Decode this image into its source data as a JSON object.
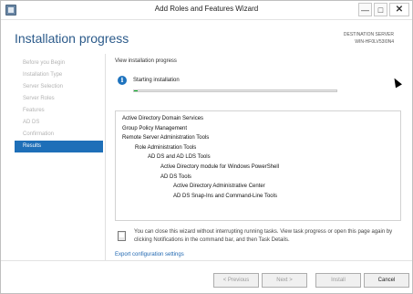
{
  "window": {
    "title": "Add Roles and Features Wizard",
    "minimize_glyph": "—",
    "maximize_glyph": "□",
    "close_glyph": "✕"
  },
  "header": {
    "title": "Installation progress",
    "destination_label": "DESTINATION SERVER",
    "destination_server": "WIN-HF0LV53I0N4"
  },
  "nav": {
    "items": [
      {
        "label": "Before you Begin",
        "active": false
      },
      {
        "label": "Installation Type",
        "active": false
      },
      {
        "label": "Server Selection",
        "active": false
      },
      {
        "label": "Server Roles",
        "active": false
      },
      {
        "label": "Features",
        "active": false
      },
      {
        "label": "AD DS",
        "active": false
      },
      {
        "label": "Confirmation",
        "active": false
      },
      {
        "label": "Results",
        "active": true
      }
    ]
  },
  "content": {
    "view_progress_label": "View installation progress",
    "status_text": "Starting installation",
    "progress": 0.02,
    "features": [
      {
        "label": "Active Directory Domain Services",
        "level": 0
      },
      {
        "label": "Group Policy Management",
        "level": 0
      },
      {
        "label": "Remote Server Administration Tools",
        "level": 0
      },
      {
        "label": "Role Administration Tools",
        "level": 1
      },
      {
        "label": "AD DS and AD LDS Tools",
        "level": 2
      },
      {
        "label": "Active Directory module for Windows PowerShell",
        "level": 3
      },
      {
        "label": "AD DS Tools",
        "level": 3
      },
      {
        "label": "Active Directory Administrative Center",
        "level": 4
      },
      {
        "label": "AD DS Snap-Ins and Command-Line Tools",
        "level": 4
      }
    ],
    "notice": "You can close this wizard without interrupting running tasks. View task progress or open this page again by clicking Notifications in the command bar, and then Task Details.",
    "export_link": "Export configuration settings"
  },
  "footer": {
    "previous": "< Previous",
    "next": "Next >",
    "install": "Install",
    "cancel": "Cancel"
  },
  "colors": {
    "accent": "#1e6fb8",
    "header_title": "#2b5a8a",
    "link": "#1e66b0"
  }
}
